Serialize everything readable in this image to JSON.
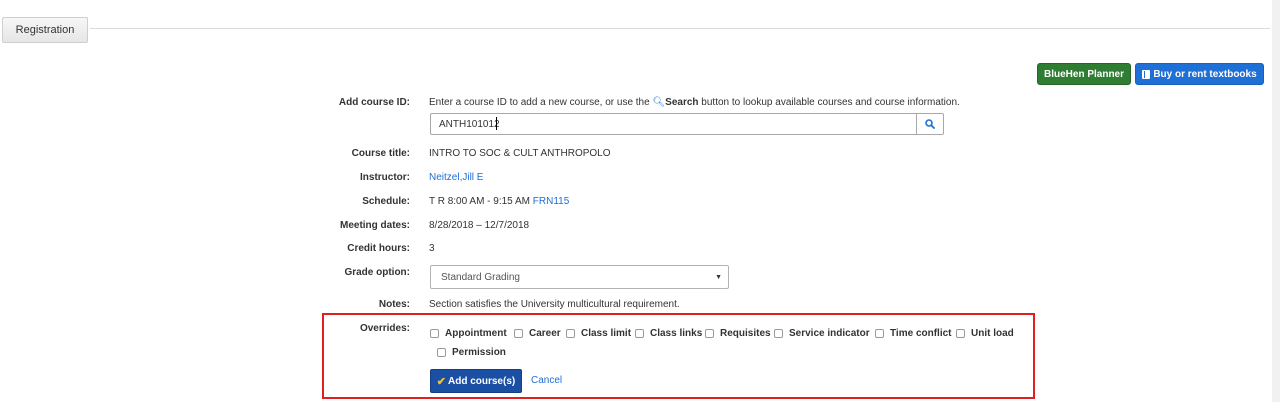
{
  "tab": {
    "label": "Registration"
  },
  "top_buttons": {
    "bluehen": "BlueHen Planner",
    "textbooks": "Buy or rent textbooks"
  },
  "add_course": {
    "label": "Add course ID:",
    "hint_pre": "Enter a course ID to add a new course, or use the ",
    "hint_search": "Search",
    "hint_post": " button to lookup available courses and course information.",
    "input_value": "ANTH101012"
  },
  "details": {
    "course_title_label": "Course title:",
    "course_title": "INTRO TO SOC & CULT ANTHROPOLO",
    "instructor_label": "Instructor:",
    "instructor": "Neitzel,Jill E",
    "schedule_label": "Schedule:",
    "schedule_time": "T R 8:00 AM - 9:15 AM",
    "schedule_room": "FRN115",
    "meeting_dates_label": "Meeting dates:",
    "meeting_dates": "8/28/2018 – 12/7/2018",
    "credit_hours_label": "Credit hours:",
    "credit_hours": "3",
    "grade_option_label": "Grade option:",
    "grade_option": "Standard Grading",
    "notes_label": "Notes:",
    "notes": "Section satisfies the University multicultural requirement."
  },
  "overrides": {
    "label": "Overrides:",
    "items": [
      "Appointment",
      "Career",
      "Class limit",
      "Class links",
      "Requisites",
      "Service indicator",
      "Time conflict",
      "Unit load",
      "Permission"
    ]
  },
  "actions": {
    "add": "Add course(s)",
    "cancel": "Cancel"
  },
  "colors": {
    "green_button": "#2e7d32",
    "blue_button": "#1e6fd6",
    "primary_button": "#1b4fa3",
    "highlight_box": "#e02020"
  }
}
